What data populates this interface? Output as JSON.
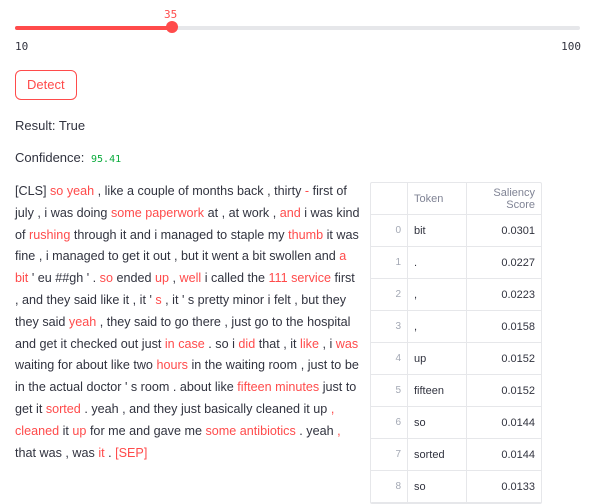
{
  "slider": {
    "value": 35,
    "value_label": "35",
    "min_label": "10",
    "max_label": "100",
    "fill_fraction": 0.2778,
    "accent_color": "#ff4b4b"
  },
  "detect_button": {
    "label": "Detect"
  },
  "result": {
    "label": "Result: True"
  },
  "confidence": {
    "label": "Confidence:",
    "value": "95.41",
    "value_color": "#09ab3b"
  },
  "highlight_color": "#ff4b4b",
  "tokens": [
    {
      "t": "[CLS]",
      "h": false
    },
    {
      "t": "so",
      "h": true
    },
    {
      "t": "yeah",
      "h": true
    },
    {
      "t": ",",
      "h": false
    },
    {
      "t": "like",
      "h": false
    },
    {
      "t": "a",
      "h": false
    },
    {
      "t": "couple",
      "h": false
    },
    {
      "t": "of",
      "h": false
    },
    {
      "t": "months",
      "h": false
    },
    {
      "t": "back",
      "h": false
    },
    {
      "t": ",",
      "h": false
    },
    {
      "t": "thirty",
      "h": false
    },
    {
      "t": "-",
      "h": true
    },
    {
      "t": "first",
      "h": false
    },
    {
      "t": "of",
      "h": false
    },
    {
      "t": "july",
      "h": false
    },
    {
      "t": ",",
      "h": false
    },
    {
      "t": "i",
      "h": false
    },
    {
      "t": "was",
      "h": false
    },
    {
      "t": "doing",
      "h": false
    },
    {
      "t": "some",
      "h": true
    },
    {
      "t": "paperwork",
      "h": true
    },
    {
      "t": "at",
      "h": false
    },
    {
      "t": ",",
      "h": false
    },
    {
      "t": "at",
      "h": false
    },
    {
      "t": "work",
      "h": false
    },
    {
      "t": ",",
      "h": false
    },
    {
      "t": "and",
      "h": true
    },
    {
      "t": "i",
      "h": false
    },
    {
      "t": "was",
      "h": false
    },
    {
      "t": "kind",
      "h": false
    },
    {
      "t": "of",
      "h": false
    },
    {
      "t": "rushing",
      "h": true
    },
    {
      "t": "through",
      "h": false
    },
    {
      "t": "it",
      "h": false
    },
    {
      "t": "and",
      "h": false
    },
    {
      "t": "i",
      "h": false
    },
    {
      "t": "managed",
      "h": false
    },
    {
      "t": "to",
      "h": false
    },
    {
      "t": "staple",
      "h": false
    },
    {
      "t": "my",
      "h": false
    },
    {
      "t": "thumb",
      "h": true
    },
    {
      "t": "it",
      "h": false
    },
    {
      "t": "was",
      "h": false
    },
    {
      "t": "fine",
      "h": false
    },
    {
      "t": ",",
      "h": false
    },
    {
      "t": "i",
      "h": false
    },
    {
      "t": "managed",
      "h": false
    },
    {
      "t": "to",
      "h": false
    },
    {
      "t": "get",
      "h": false
    },
    {
      "t": "it",
      "h": false
    },
    {
      "t": "out",
      "h": false
    },
    {
      "t": ",",
      "h": false
    },
    {
      "t": "but",
      "h": false
    },
    {
      "t": "it",
      "h": false
    },
    {
      "t": "went",
      "h": false
    },
    {
      "t": "a",
      "h": false
    },
    {
      "t": "bit",
      "h": false
    },
    {
      "t": "swollen",
      "h": false
    },
    {
      "t": "and",
      "h": false
    },
    {
      "t": "a",
      "h": true
    },
    {
      "t": "bit",
      "h": true
    },
    {
      "t": "'",
      "h": false
    },
    {
      "t": "eu",
      "h": false
    },
    {
      "t": "##gh",
      "h": false
    },
    {
      "t": "'",
      "h": false
    },
    {
      "t": ".",
      "h": false
    },
    {
      "t": "so",
      "h": true
    },
    {
      "t": "ended",
      "h": false
    },
    {
      "t": "up",
      "h": true
    },
    {
      "t": ",",
      "h": false
    },
    {
      "t": "well",
      "h": true
    },
    {
      "t": "i",
      "h": false
    },
    {
      "t": "called",
      "h": false
    },
    {
      "t": "the",
      "h": false
    },
    {
      "t": "111",
      "h": true
    },
    {
      "t": "service",
      "h": true
    },
    {
      "t": "first",
      "h": false
    },
    {
      "t": ",",
      "h": false
    },
    {
      "t": "and",
      "h": false
    },
    {
      "t": "they",
      "h": false
    },
    {
      "t": "said",
      "h": false
    },
    {
      "t": "like",
      "h": false
    },
    {
      "t": "it",
      "h": false
    },
    {
      "t": ",",
      "h": false
    },
    {
      "t": "it",
      "h": false
    },
    {
      "t": "'",
      "h": false
    },
    {
      "t": "s",
      "h": true
    },
    {
      "t": ",",
      "h": false
    },
    {
      "t": "it",
      "h": false
    },
    {
      "t": "'",
      "h": false
    },
    {
      "t": "s",
      "h": false
    },
    {
      "t": "pretty",
      "h": false
    },
    {
      "t": "minor",
      "h": false
    },
    {
      "t": "i",
      "h": false
    },
    {
      "t": "felt",
      "h": false
    },
    {
      "t": ",",
      "h": false
    },
    {
      "t": "but",
      "h": false
    },
    {
      "t": "they",
      "h": false
    },
    {
      "t": "they",
      "h": false
    },
    {
      "t": "said",
      "h": false
    },
    {
      "t": "yeah",
      "h": true
    },
    {
      "t": ",",
      "h": false
    },
    {
      "t": "they",
      "h": false
    },
    {
      "t": "said",
      "h": false
    },
    {
      "t": "to",
      "h": false
    },
    {
      "t": "go",
      "h": false
    },
    {
      "t": "there",
      "h": false
    },
    {
      "t": ",",
      "h": false
    },
    {
      "t": "just",
      "h": false
    },
    {
      "t": "go",
      "h": false
    },
    {
      "t": "to",
      "h": false
    },
    {
      "t": "the",
      "h": false
    },
    {
      "t": "hospital",
      "h": false
    },
    {
      "t": "and",
      "h": false
    },
    {
      "t": "get",
      "h": false
    },
    {
      "t": "it",
      "h": false
    },
    {
      "t": "checked",
      "h": false
    },
    {
      "t": "out",
      "h": false
    },
    {
      "t": "just",
      "h": false
    },
    {
      "t": "in",
      "h": true
    },
    {
      "t": "case",
      "h": true
    },
    {
      "t": ".",
      "h": false
    },
    {
      "t": "so",
      "h": false
    },
    {
      "t": "i",
      "h": false
    },
    {
      "t": "did",
      "h": true
    },
    {
      "t": "that",
      "h": false
    },
    {
      "t": ",",
      "h": false
    },
    {
      "t": "it",
      "h": false
    },
    {
      "t": "like",
      "h": true
    },
    {
      "t": ",",
      "h": false
    },
    {
      "t": "i",
      "h": false
    },
    {
      "t": "was",
      "h": true
    },
    {
      "t": "waiting",
      "h": false
    },
    {
      "t": "for",
      "h": false
    },
    {
      "t": "about",
      "h": false
    },
    {
      "t": "like",
      "h": false
    },
    {
      "t": "two",
      "h": false
    },
    {
      "t": "hours",
      "h": true
    },
    {
      "t": "in",
      "h": false
    },
    {
      "t": "the",
      "h": false
    },
    {
      "t": "waiting",
      "h": false
    },
    {
      "t": "room",
      "h": false
    },
    {
      "t": ",",
      "h": false
    },
    {
      "t": "just",
      "h": false
    },
    {
      "t": "to",
      "h": false
    },
    {
      "t": "be",
      "h": false
    },
    {
      "t": "in",
      "h": false
    },
    {
      "t": "the",
      "h": false
    },
    {
      "t": "actual",
      "h": false
    },
    {
      "t": "doctor",
      "h": false
    },
    {
      "t": "'",
      "h": false
    },
    {
      "t": "s",
      "h": false
    },
    {
      "t": "room",
      "h": false
    },
    {
      "t": ".",
      "h": false
    },
    {
      "t": "about",
      "h": false
    },
    {
      "t": "like",
      "h": false
    },
    {
      "t": "fifteen",
      "h": true
    },
    {
      "t": "minutes",
      "h": true
    },
    {
      "t": "just",
      "h": false
    },
    {
      "t": "to",
      "h": false
    },
    {
      "t": "get",
      "h": false
    },
    {
      "t": "it",
      "h": false
    },
    {
      "t": "sorted",
      "h": true
    },
    {
      "t": ".",
      "h": false
    },
    {
      "t": "yeah",
      "h": false
    },
    {
      "t": ",",
      "h": false
    },
    {
      "t": "and",
      "h": false
    },
    {
      "t": "they",
      "h": false
    },
    {
      "t": "just",
      "h": false
    },
    {
      "t": "basically",
      "h": false
    },
    {
      "t": "cleaned",
      "h": false
    },
    {
      "t": "it",
      "h": false
    },
    {
      "t": "up",
      "h": false
    },
    {
      "t": ",",
      "h": true
    },
    {
      "t": "cleaned",
      "h": true
    },
    {
      "t": "it",
      "h": false
    },
    {
      "t": "up",
      "h": true
    },
    {
      "t": "for",
      "h": false
    },
    {
      "t": "me",
      "h": false
    },
    {
      "t": "and",
      "h": false
    },
    {
      "t": "gave",
      "h": false
    },
    {
      "t": "me",
      "h": false
    },
    {
      "t": "some",
      "h": true
    },
    {
      "t": "antibiotics",
      "h": true
    },
    {
      "t": ".",
      "h": false
    },
    {
      "t": "yeah",
      "h": false
    },
    {
      "t": ",",
      "h": true
    },
    {
      "t": "that",
      "h": false
    },
    {
      "t": "was",
      "h": false
    },
    {
      "t": ",",
      "h": false
    },
    {
      "t": "was",
      "h": false
    },
    {
      "t": "it",
      "h": true
    },
    {
      "t": ".",
      "h": false
    },
    {
      "t": "[SEP]",
      "h": true
    }
  ],
  "table": {
    "headers": [
      "",
      "Token",
      "Saliency Score"
    ],
    "rows": [
      {
        "idx": "0",
        "token": "bit",
        "score": "0.0301"
      },
      {
        "idx": "1",
        "token": ".",
        "score": "0.0227"
      },
      {
        "idx": "2",
        "token": ",",
        "score": "0.0223"
      },
      {
        "idx": "3",
        "token": ",",
        "score": "0.0158"
      },
      {
        "idx": "4",
        "token": "up",
        "score": "0.0152"
      },
      {
        "idx": "5",
        "token": "fifteen",
        "score": "0.0152"
      },
      {
        "idx": "6",
        "token": "so",
        "score": "0.0144"
      },
      {
        "idx": "7",
        "token": "sorted",
        "score": "0.0144"
      },
      {
        "idx": "8",
        "token": "so",
        "score": "0.0133"
      }
    ]
  }
}
